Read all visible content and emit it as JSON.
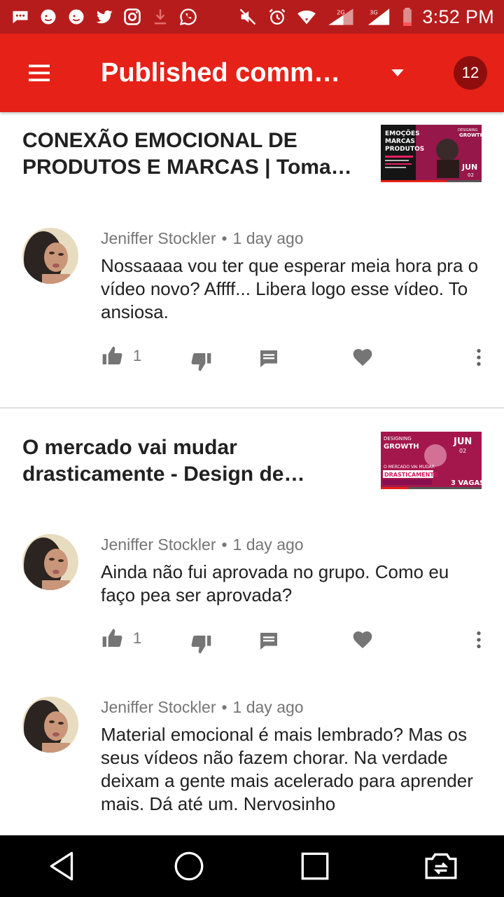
{
  "status_bar": {
    "time": "3:52 PM",
    "icons_left": [
      "message-icon",
      "mailchimp-icon",
      "mailchimp-icon",
      "twitter-icon",
      "instagram-icon",
      "download-icon",
      "whatsapp-icon"
    ],
    "icons_right": [
      "mute-icon",
      "alarm-icon",
      "wifi-icon",
      "signal-2g-icon",
      "signal-3g-icon",
      "battery-icon"
    ],
    "signal_1_label": "2G",
    "signal_2_label": "3G"
  },
  "app_bar": {
    "title": "Published comments",
    "badge_count": "12",
    "color": "#e62117"
  },
  "sections": [
    {
      "video_title": "CONEXÃO EMOCIONAL DE PRODUTOS E MARCAS | Tomada de decisão",
      "thumbnail_text": [
        "EMOÇÕES",
        "MARCAS",
        "PRODUTOS",
        "DESIGNING",
        "GROWTH",
        "JUN",
        "02"
      ],
      "thumbnail_progress": 0.65,
      "comments": [
        {
          "author": "Jeniffer Stockler",
          "time": "1 day ago",
          "text": "Nossaaaa vou ter que esperar meia hora pra o vídeo novo? Affff... Libera logo esse vídeo. To ansiosa.",
          "likes": "1"
        }
      ]
    },
    {
      "video_title": "O mercado vai mudar drasticamente - Design de Inteligência",
      "thumbnail_text": [
        "DESIGNING",
        "GROWTH",
        "JUN",
        "02",
        "O MERCADO VAI MUDAR",
        "DRASTICAMENTE",
        "3 VAGAS"
      ],
      "thumbnail_progress": 0.28,
      "comments": [
        {
          "author": "Jeniffer Stockler",
          "time": "1 day ago",
          "text": "Ainda não fui aprovada no grupo. Como eu faço pea ser aprovada?",
          "likes": "1"
        },
        {
          "author": "Jeniffer Stockler",
          "time": "1 day ago",
          "text": "Material emocional é mais lembrado? Mas os seus vídeos não fazem chorar. Na verdade deixam a gente mais acelerado para aprender mais. Dá até um. Nervosinho",
          "likes": ""
        }
      ]
    }
  ],
  "nav_bar": {
    "buttons": [
      "back-icon",
      "home-icon",
      "recents-icon",
      "screen-share-icon"
    ]
  }
}
